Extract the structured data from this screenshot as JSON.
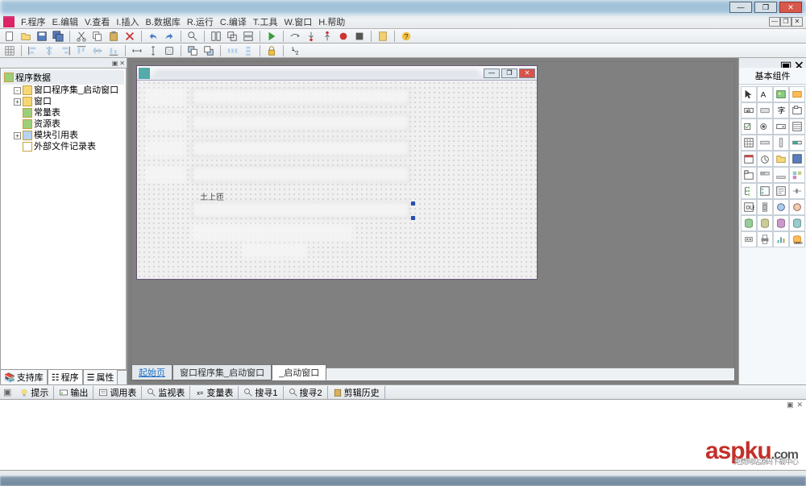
{
  "menu": {
    "items": [
      "F.程序",
      "E.编辑",
      "V.查看",
      "I.插入",
      "B.数据库",
      "R.运行",
      "C.编译",
      "T.工具",
      "W.窗口",
      "H.帮助"
    ]
  },
  "tree": {
    "title": "程序数据",
    "nodes": [
      {
        "exp": "-",
        "icon": "fld",
        "label": "窗口程序集_启动窗口"
      },
      {
        "exp": "+",
        "icon": "fld",
        "label": "窗口"
      },
      {
        "exp": "",
        "icon": "db",
        "label": "常量表"
      },
      {
        "exp": "",
        "icon": "db",
        "label": "资源表"
      },
      {
        "exp": "+",
        "icon": "mod",
        "label": "模块引用表"
      },
      {
        "exp": "",
        "icon": "doc",
        "label": "外部文件记录表"
      }
    ]
  },
  "left_tabs": [
    {
      "icon": "lib",
      "label": "支持库"
    },
    {
      "icon": "prog",
      "label": "程序"
    },
    {
      "icon": "prop",
      "label": "属性"
    }
  ],
  "doc_tabs": [
    {
      "label": "起始页",
      "kind": "link"
    },
    {
      "label": "窗口程序集_启动窗口",
      "kind": "normal"
    },
    {
      "label": "_启动窗口",
      "kind": "active"
    }
  ],
  "right_panel": {
    "title": "基本组件"
  },
  "bottom_tabs": [
    {
      "icon": "bulb",
      "label": "提示"
    },
    {
      "icon": "out",
      "label": "输出"
    },
    {
      "icon": "call",
      "label": "调用表"
    },
    {
      "icon": "watch",
      "label": "监视表"
    },
    {
      "icon": "var",
      "label": "变量表"
    },
    {
      "icon": "s1",
      "label": "搜寻1"
    },
    {
      "icon": "s2",
      "label": "搜寻2"
    },
    {
      "icon": "clip",
      "label": "剪辑历史"
    }
  ],
  "form_label": "土上匝",
  "watermark": {
    "brand_a": "asp",
    "brand_b": "ku",
    "tld": ".com",
    "sub": "免费网站源码下载中心"
  }
}
